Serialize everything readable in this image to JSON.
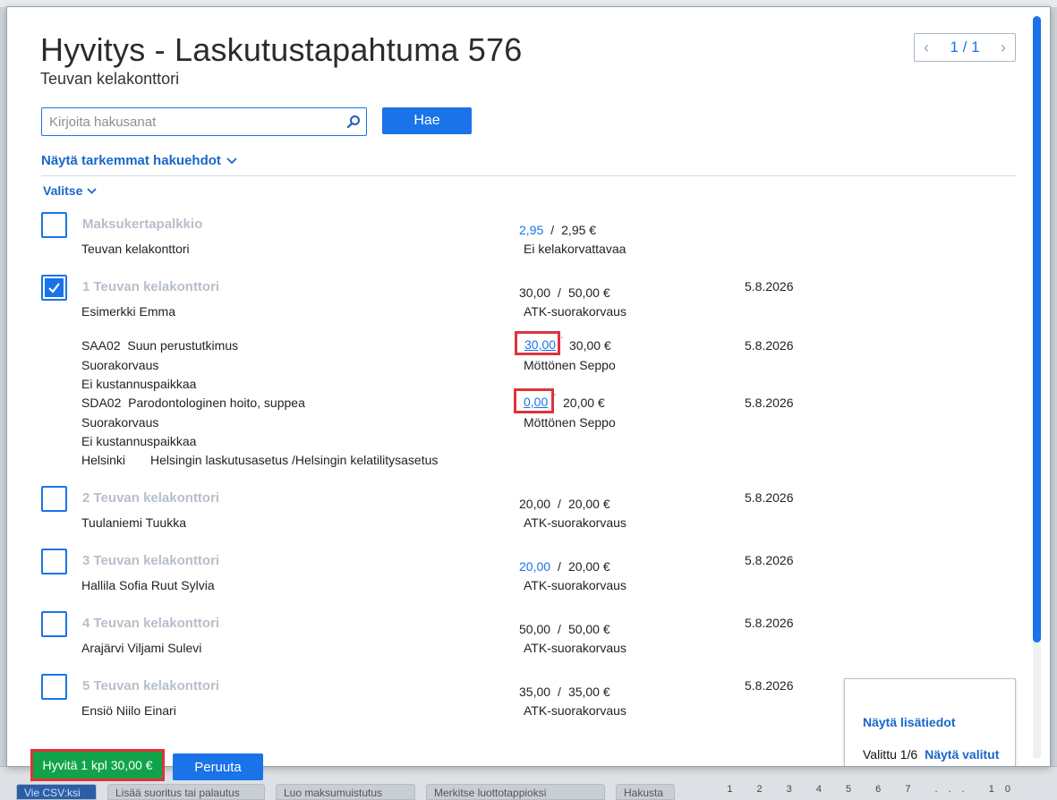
{
  "background": {
    "tabs": [
      "Vie CSV:ksi",
      "Lisää suoritus tai palautus",
      "Luo maksumuistutus",
      "Merkitse luottotappioksi",
      "Hakusta"
    ],
    "pages": "1 2 3 4 5 6 7 ... 10"
  },
  "modal": {
    "title": "Hyvitys - Laskutustapahtuma 576",
    "subtitle": "Teuvan kelakonttori",
    "pager": {
      "text": "1 / 1"
    },
    "search": {
      "placeholder": "Kirjoita hakusanat"
    },
    "search_button": "Hae",
    "advanced_link": "Näytä tarkemmat hakuehdot",
    "select_link": "Valitse"
  },
  "rows": [
    {
      "title": "Maksukertapalkkio",
      "name": "Teuvan kelakonttori",
      "amount": "2,95",
      "total": "2,95 €",
      "status": "Ei kelakorvattavaa",
      "date": "",
      "checked": false
    },
    {
      "title": "1 Teuvan kelakonttori",
      "name": "Esimerkki Emma",
      "amount": "30,00",
      "total": "50,00 €",
      "status": "ATK-suorakorvaus",
      "date": "5.8.2026",
      "checked": true
    },
    {
      "title": "2 Teuvan kelakonttori",
      "name": "Tuulaniemi Tuukka",
      "amount": "20,00",
      "total": "20,00 €",
      "status": "ATK-suorakorvaus",
      "date": "5.8.2026",
      "checked": false
    },
    {
      "title": "3 Teuvan kelakonttori",
      "name": "Hallila Sofia Ruut Sylvia",
      "amount": "20,00",
      "total": "20,00 €",
      "status": "ATK-suorakorvaus",
      "date": "5.8.2026",
      "checked": false
    },
    {
      "title": "4 Teuvan kelakonttori",
      "name": "Arajärvi Viljami Sulevi",
      "amount": "50,00",
      "total": "50,00 €",
      "status": "ATK-suorakorvaus",
      "date": "5.8.2026",
      "checked": false
    },
    {
      "title": "5 Teuvan kelakonttori",
      "name": "Ensiö Niilo Einari",
      "amount": "35,00",
      "total": "35,00 €",
      "status": "ATK-suorakorvaus",
      "date": "5.8.2026",
      "checked": false
    }
  ],
  "subitems": [
    {
      "code": "SAA02",
      "desc": "Suun perustutkimus",
      "type": "Suorakorvaus",
      "cost_center": "Ei kustannuspaikkaa",
      "amount": "30,00",
      "total": "30,00 €",
      "person": "Möttönen Seppo",
      "date": "5.8.2026"
    },
    {
      "code": "SDA02",
      "desc": "Parodontologinen hoito, suppea",
      "type": "Suorakorvaus",
      "cost_center": "Ei kustannuspaikkaa",
      "amount": "0,00",
      "total": "20,00 €",
      "person": "Möttönen Seppo",
      "date": "5.8.2026"
    }
  ],
  "location": {
    "city": "Helsinki",
    "settings": "Helsingin laskutusasetus /Helsingin kelatilitysasetus"
  },
  "info_panel": {
    "more_link": "Näytä lisätiedot",
    "selected_text": "Valittu 1/6",
    "show_selected_link": "Näytä valitut"
  },
  "footer": {
    "credit_button": "Hyvitä 1 kpl 30,00 €",
    "cancel_button": "Peruuta"
  }
}
